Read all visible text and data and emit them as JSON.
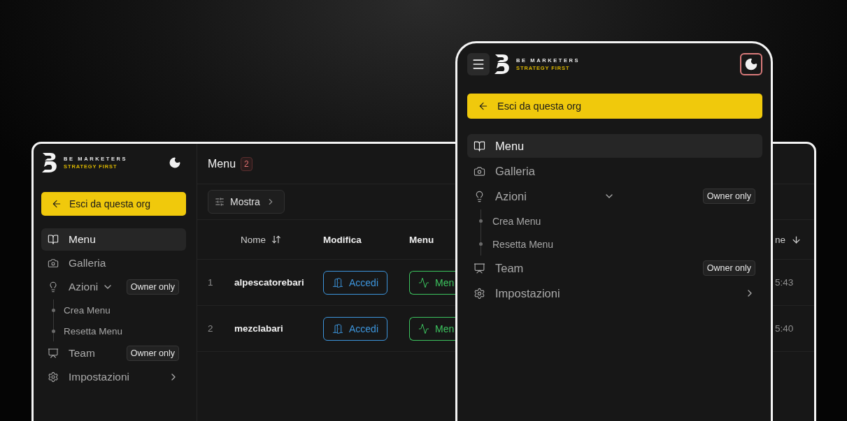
{
  "desktop": {
    "brand": {
      "name": "BE MARKETERS",
      "tagline": "STRATEGY FIRST"
    },
    "exit_button": "Esci da questa org",
    "nav": [
      {
        "label": "Menu",
        "kind": "book",
        "selected": true
      },
      {
        "label": "Galleria",
        "kind": "camera",
        "selected": false
      },
      {
        "label": "Azioni",
        "kind": "bulb",
        "selected": false,
        "expanded": true,
        "badge": "Owner only",
        "children": [
          {
            "label": "Crea Menu"
          },
          {
            "label": "Resetta Menu"
          }
        ]
      },
      {
        "label": "Team",
        "kind": "team",
        "selected": false,
        "badge": "Owner only"
      },
      {
        "label": "Impostazioni",
        "kind": "gear",
        "selected": false,
        "expanded": false
      }
    ],
    "page": {
      "title": "Menu",
      "count": "2"
    },
    "toolbar": {
      "button": "Mostra"
    },
    "table": {
      "columns": [
        {
          "label": "Nome"
        },
        {
          "label": "Modifica"
        },
        {
          "label": "Menu"
        },
        {
          "label": "ne"
        }
      ],
      "rows": [
        {
          "index": "1",
          "name": "alpescatorebari",
          "edit": "Accedi",
          "menu": "Men",
          "column_4": "5:43"
        },
        {
          "index": "2",
          "name": "mezclabari",
          "edit": "Accedi",
          "menu": "Men",
          "column_4": "5:40"
        }
      ]
    }
  },
  "mobile": {
    "brand": {
      "name": "BE MARKETERS",
      "tagline": "STRATEGY FIRST"
    },
    "exit_button": "Esci da questa org",
    "nav": [
      {
        "label": "Menu",
        "kind": "book",
        "selected": true
      },
      {
        "label": "Galleria",
        "kind": "camera",
        "selected": false
      },
      {
        "label": "Azioni",
        "kind": "bulb",
        "selected": false,
        "expanded": true,
        "badge": "Owner only",
        "children": [
          {
            "label": "Crea Menu"
          },
          {
            "label": "Resetta Menu"
          }
        ]
      },
      {
        "label": "Team",
        "kind": "team",
        "selected": false,
        "badge": "Owner only"
      },
      {
        "label": "Impostazioni",
        "kind": "gear",
        "selected": false,
        "expanded": false
      }
    ]
  }
}
